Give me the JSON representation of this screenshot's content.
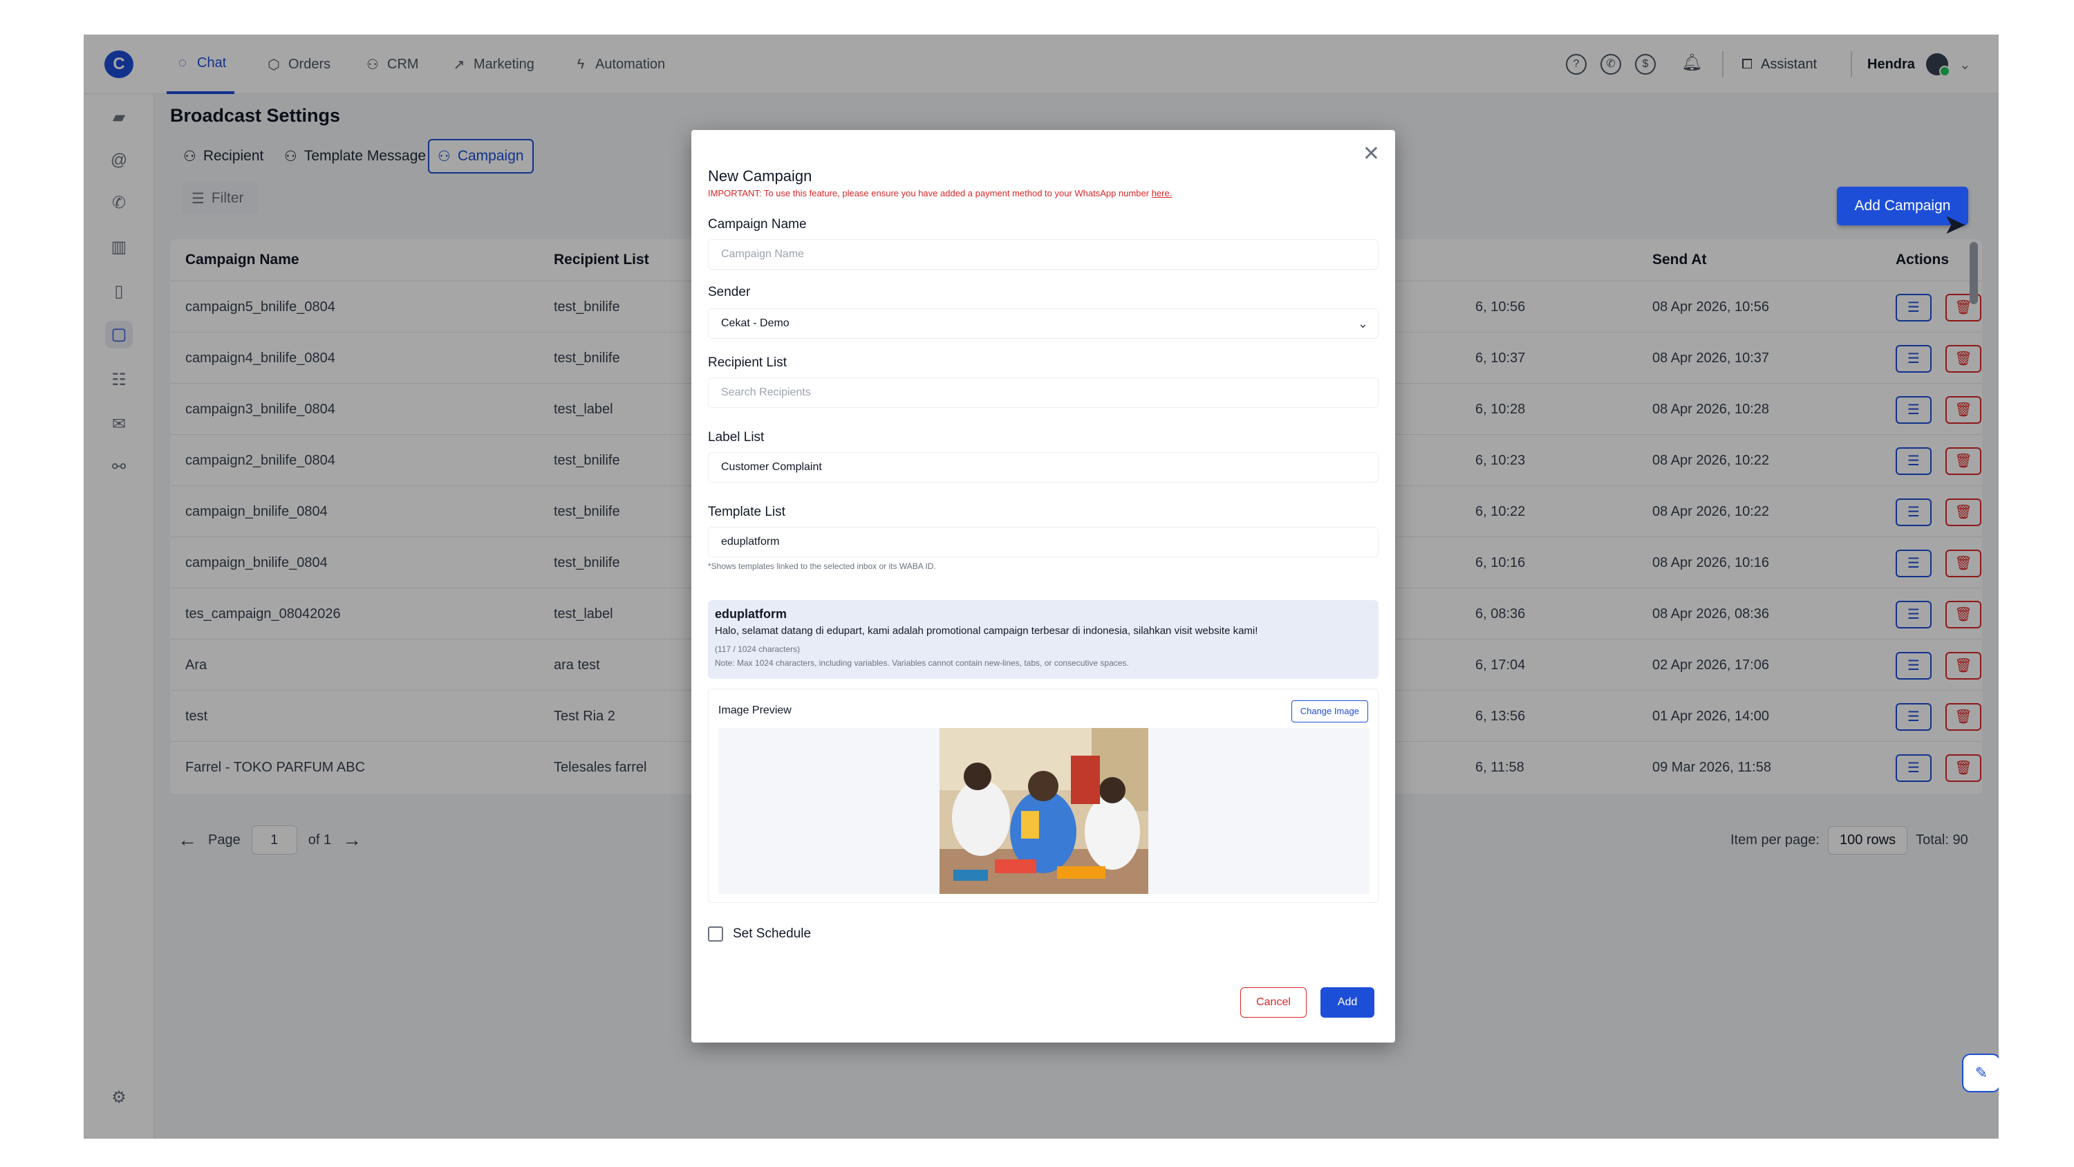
{
  "nav": {
    "logo": "C",
    "tabs": [
      {
        "label": "Chat",
        "icon": "chat-bubble-icon"
      },
      {
        "label": "Orders",
        "icon": "box-icon"
      },
      {
        "label": "CRM",
        "icon": "users-icon"
      },
      {
        "label": "Marketing",
        "icon": "trend-icon"
      },
      {
        "label": "Automation",
        "icon": "bolt-icon"
      }
    ],
    "assistant": "Assistant",
    "user_name": "Hendra"
  },
  "colors": {
    "accent": "#1d4ed8",
    "danger": "#dc2626",
    "online": "#22c55e"
  },
  "page": {
    "title": "Broadcast Settings",
    "subtabs": [
      "Recipient",
      "Template Message",
      "Campaign"
    ],
    "filter": "Filter",
    "add_button": "Add Campaign"
  },
  "table": {
    "headers": [
      "Campaign Name",
      "Recipient List",
      "Send At",
      "Actions"
    ],
    "rows": [
      {
        "name": "campaign5_bnilife_0804",
        "recipient": "test_bnilife",
        "created": "6, 10:56",
        "send_at": "08 Apr 2026, 10:56"
      },
      {
        "name": "campaign4_bnilife_0804",
        "recipient": "test_bnilife",
        "created": "6, 10:37",
        "send_at": "08 Apr 2026, 10:37"
      },
      {
        "name": "campaign3_bnilife_0804",
        "recipient": "test_label",
        "created": "6, 10:28",
        "send_at": "08 Apr 2026, 10:28"
      },
      {
        "name": "campaign2_bnilife_0804",
        "recipient": "test_bnilife",
        "created": "6, 10:23",
        "send_at": "08 Apr 2026, 10:22"
      },
      {
        "name": "campaign_bnilife_0804",
        "recipient": "test_bnilife",
        "created": "6, 10:22",
        "send_at": "08 Apr 2026, 10:22"
      },
      {
        "name": "campaign_bnilife_0804",
        "recipient": "test_bnilife",
        "created": "6, 10:16",
        "send_at": "08 Apr 2026, 10:16"
      },
      {
        "name": "tes_campaign_08042026",
        "recipient": "test_label",
        "created": "6, 08:36",
        "send_at": "08 Apr 2026, 08:36"
      },
      {
        "name": "Ara",
        "recipient": "ara test",
        "created": "6, 17:04",
        "send_at": "02 Apr 2026, 17:06"
      },
      {
        "name": "test",
        "recipient": "Test Ria 2",
        "created": "6, 13:56",
        "send_at": "01 Apr 2026, 14:00"
      },
      {
        "name": "Farrel - TOKO PARFUM ABC",
        "recipient": "Telesales farrel",
        "created": "6, 11:58",
        "send_at": "09 Mar 2026, 11:58"
      }
    ]
  },
  "pager": {
    "page_label": "Page",
    "page": "1",
    "of": "of 1",
    "per_page_label": "Item per page:",
    "per_page": "100 rows",
    "total": "Total: 90"
  },
  "modal": {
    "title": "New Campaign",
    "note": "IMPORTANT: To use this feature, please ensure you have added a payment method to your WhatsApp number ",
    "note_link": "here.",
    "campaign_name_label": "Campaign Name",
    "campaign_name_placeholder": "Campaign Name",
    "sender_label": "Sender",
    "sender_value": "Cekat - Demo",
    "recipient_label": "Recipient List",
    "recipient_placeholder": "Search Recipients",
    "label_list_label": "Label List",
    "label_list_value": "Customer Complaint",
    "template_label": "Template List",
    "template_value": "eduplatform",
    "template_help": "*Shows templates linked to the selected inbox or its WABA ID.",
    "template_preview": {
      "name": "eduplatform",
      "text": "Halo, selamat datang di edupart, kami adalah promotional campaign terbesar di indonesia, silahkan visit website kami!",
      "count": "(117 / 1024 characters)",
      "limit_note": "Note: Max 1024 characters, including variables. Variables cannot contain new-lines, tabs, or consecutive spaces."
    },
    "image_preview_label": "Image Preview",
    "change_image": "Change Image",
    "schedule_label": "Set Schedule",
    "cancel": "Cancel",
    "add": "Add"
  }
}
